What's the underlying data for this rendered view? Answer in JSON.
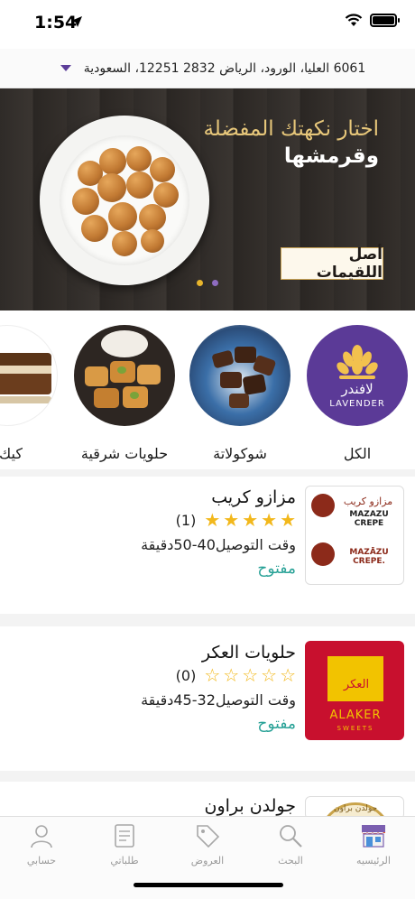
{
  "status_bar": {
    "time": "1:54"
  },
  "address": {
    "text": "6061 العليا، الورود، الرياض 2832 12251، السعودية"
  },
  "banner": {
    "title_line1": "اختار نكهتك المفضلة",
    "title_line2": "وقرمشها",
    "logo_text": "أصل اللقيمات",
    "dots": [
      "#e8b52c",
      "#8e6cc0"
    ]
  },
  "categories": [
    {
      "label": "الكل",
      "logo_text": "لافندر",
      "logo_sub": "LAVENDER"
    },
    {
      "label": "شوكولاتة"
    },
    {
      "label": "حلويات شرقية"
    },
    {
      "label": "كيك"
    }
  ],
  "restaurants": [
    {
      "name": "مزازو كريب",
      "stars_filled": 5,
      "rating_count": "(1)",
      "delivery_time": "وقت التوصيل40-50دقيقة",
      "status": "مفتوح",
      "logo_ar": "مزازو كريب",
      "logo_en": "MAZAZU CREPE",
      "logo_en2": "MAZĀZU CREPE."
    },
    {
      "name": "حلويات العكر",
      "stars_filled": 0,
      "rating_count": "(0)",
      "delivery_time": "وقت التوصيل32-45دقيقة",
      "status": "مفتوح",
      "logo_ar": "العكر",
      "logo_en": "ALAKER",
      "logo_en2": "SWEETS"
    },
    {
      "name": "جولدن براون",
      "logo_ar": "جولدن براون"
    }
  ],
  "tabs": [
    {
      "label": "الرئيسيه",
      "icon": "store-icon",
      "active": true
    },
    {
      "label": "البحث",
      "icon": "search-icon"
    },
    {
      "label": "العروض",
      "icon": "tag-icon"
    },
    {
      "label": "طلباتي",
      "icon": "orders-icon"
    },
    {
      "label": "حسابي",
      "icon": "profile-icon"
    }
  ],
  "colors": {
    "accent": "#27a196",
    "brand_purple": "#5c3d99",
    "star": "#f2b81c"
  }
}
